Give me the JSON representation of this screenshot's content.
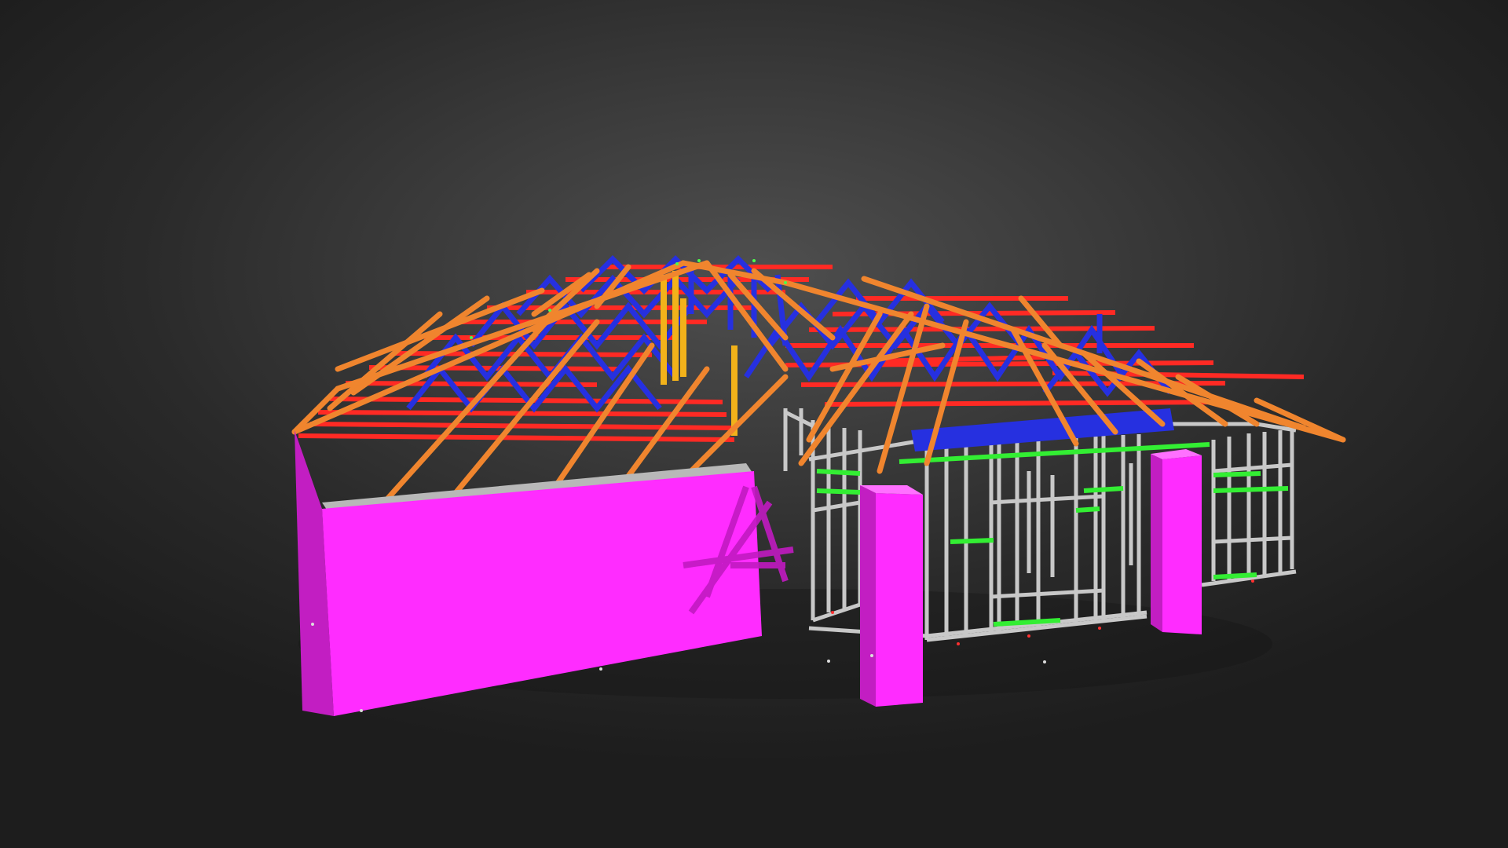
{
  "viewer": {
    "background_center": "#4f4f4f",
    "background_edge": "#1d1d1d"
  },
  "model": {
    "description_icon": "3d-house-frame-icon",
    "colors": {
      "wall_magenta": "#ff2cff",
      "wall_magenta_dark": "#b318b3",
      "roof_rafter_orange": "#f0852e",
      "roof_batten_red": "#ff2a24",
      "truss_web_blue": "#2630e0",
      "wall_frame_grey": "#c8c8c8",
      "nogging_green": "#33ee33",
      "post_yellow": "#f2b21a"
    }
  }
}
